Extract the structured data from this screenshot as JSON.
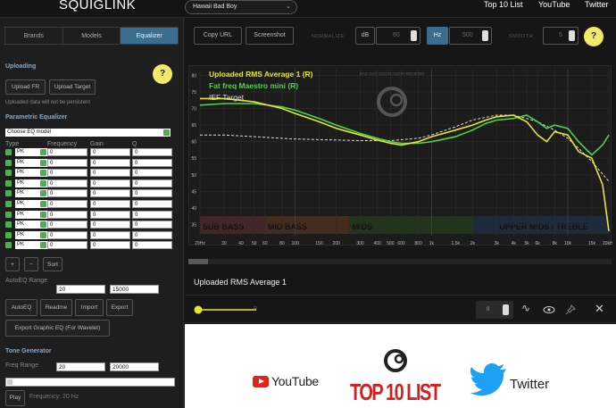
{
  "header": {
    "logo": "SQUIGLINK",
    "model": "Hawaii Bad Boy",
    "links": [
      "Top 10 List",
      "YouTube",
      "Twitter"
    ]
  },
  "tabs": [
    "Brands",
    "Models",
    "Equalizer"
  ],
  "uploading": {
    "title": "Uploading",
    "upload_fr": "Upload FR",
    "upload_target": "Upload Target",
    "note": "Uploaded data will not be persistent",
    "help": "?"
  },
  "peq": {
    "title": "Parametric Equalizer",
    "choose_model": "Choose EQ model",
    "col_type": "Type",
    "col_freq": "Frequency",
    "col_gain": "Gain",
    "col_q": "Q",
    "filter_type": "PK",
    "filter_value": "0",
    "filter_count": 10
  },
  "buttons": {
    "plus": "+",
    "minus": "−",
    "sort": "Sort",
    "autoeq_range_label": "AutoEQ Range",
    "autoeq_min": "20",
    "autoeq_max": "15000",
    "autoeq": "AutoEQ",
    "readme": "Readme",
    "import": "Import",
    "export": "Export",
    "export_graphic": "Export Graphic EQ (For Wavelet)"
  },
  "tone": {
    "title": "Tone Generator",
    "freq_range_label": "Freq Range",
    "min": "20",
    "max": "20000",
    "play": "Play",
    "frequency_label": "Frequency: 20 Hz"
  },
  "toolbar": {
    "copy_url": "Copy URL",
    "screenshot": "Screenshot",
    "normalize_label": "NORMALIZE:",
    "db": "dB",
    "db_value": "60",
    "hz": "Hz",
    "hz_value": "500",
    "smooth_label": "SMOOTH:",
    "smooth_value": "5",
    "help": "?"
  },
  "graph": {
    "watermark": "BAD GUY GOOD AUDIO REVIEWS",
    "legend": [
      {
        "name": "Uploaded RMS Average 1 (R)",
        "color": "#e6e62e"
      },
      {
        "name": "Fat freq Maestro mini (R)",
        "color": "#4dd24d"
      },
      {
        "name": "IEF Target",
        "color": "#dddddd"
      }
    ],
    "bands": [
      {
        "label": "SUB BASS",
        "color": "#4a2828"
      },
      {
        "label": "MID BASS",
        "color": "#4a3020"
      },
      {
        "label": "MIDS",
        "color": "#24381f"
      },
      {
        "label": "UPPER MIDS / TREBLE",
        "color": "#1e2e40"
      }
    ]
  },
  "chart_data": {
    "type": "line",
    "xlabel": "",
    "ylabel": "",
    "x_scale": "log",
    "xlim": [
      20,
      20000
    ],
    "ylim": [
      30,
      82
    ],
    "grid": true,
    "x_tick_labels": [
      "20Hz",
      "30",
      "40",
      "50",
      "60",
      "80",
      "100",
      "150",
      "200",
      "300",
      "400",
      "500",
      "600",
      "800",
      "1k",
      "1.5k",
      "2k",
      "3k",
      "4k",
      "5k",
      "6k",
      "8k",
      "10k",
      "15k",
      "20kHz"
    ],
    "y_tick_labels": [
      "80",
      "75",
      "70",
      "65",
      "60",
      "55",
      "50",
      "45",
      "40",
      "35"
    ],
    "legend_position": "top-left",
    "series": [
      {
        "name": "Uploaded RMS Average 1 (R)",
        "color": "#e6e62e",
        "x": [
          20,
          30,
          50,
          80,
          100,
          150,
          200,
          300,
          400,
          500,
          600,
          800,
          1000,
          1500,
          2000,
          2500,
          3000,
          4000,
          5000,
          6000,
          7000,
          8000,
          10000,
          12000,
          15000,
          18000,
          20000
        ],
        "y": [
          73,
          73,
          72,
          70,
          68.5,
          66,
          64,
          62,
          60.5,
          59.5,
          59,
          60,
          61.5,
          63.5,
          65,
          66.5,
          67.5,
          68,
          66,
          62,
          60,
          63,
          62,
          57,
          55,
          47,
          33
        ]
      },
      {
        "name": "Fat freq Maestro mini (R)",
        "color": "#4dd24d",
        "x": [
          20,
          30,
          50,
          80,
          100,
          150,
          200,
          300,
          400,
          500,
          600,
          800,
          1000,
          1500,
          2000,
          2500,
          3000,
          4000,
          5000,
          6000,
          7000,
          8000,
          10000,
          12000,
          15000,
          18000,
          20000
        ],
        "y": [
          71,
          71.5,
          71.5,
          70.5,
          69.5,
          67,
          65,
          62.5,
          61,
          60,
          59.5,
          59.5,
          60,
          61.5,
          63.5,
          65.5,
          66.5,
          67,
          68,
          66,
          64,
          65,
          64,
          60,
          56,
          59,
          62
        ]
      },
      {
        "name": "IEF Target",
        "color": "#dddddd",
        "x": [
          20,
          30,
          50,
          80,
          100,
          200,
          300,
          500,
          800,
          1000,
          1500,
          2000,
          3000,
          4000,
          5000,
          6000,
          8000,
          10000,
          12000,
          15000,
          20000
        ],
        "y": [
          62,
          62,
          61.5,
          61,
          60.8,
          60.5,
          60.3,
          60.3,
          61,
          62,
          64.5,
          66.5,
          68,
          68,
          67,
          66,
          63.5,
          61,
          58,
          54,
          48
        ]
      }
    ]
  },
  "list": {
    "title": "Uploaded RMS Average 1",
    "suffix": "R",
    "offset": "0"
  },
  "ad": {
    "youtube": "YouTube",
    "top10": "TOP 10 LIST",
    "twitter": "Twitter"
  }
}
